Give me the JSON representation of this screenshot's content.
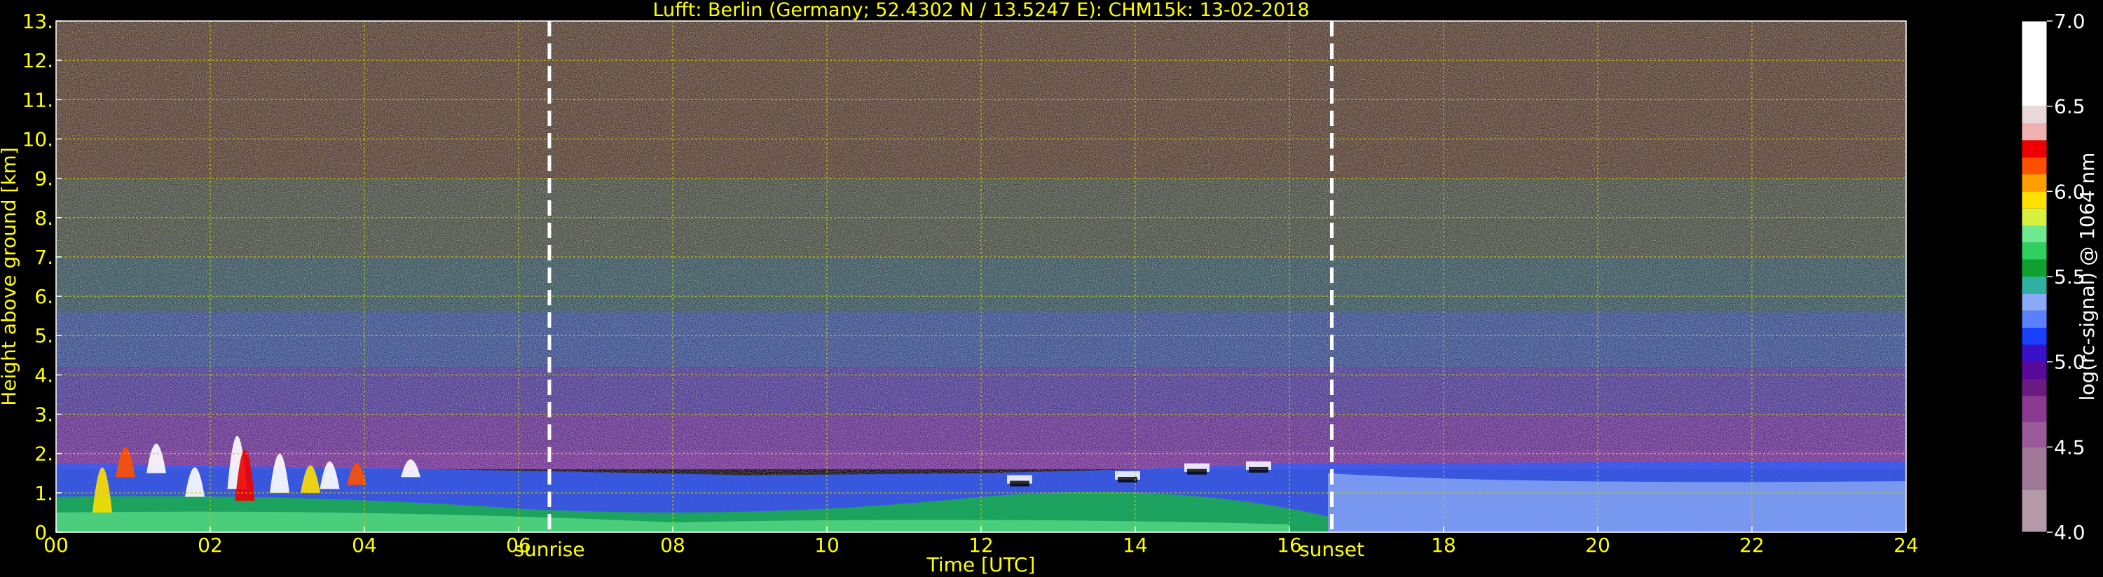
{
  "chart_data": {
    "type": "heatmap",
    "title": "Lufft: Berlin (Germany; 52.4302 N / 13.5247 E):    CHM15k: 13-02-2018",
    "xlabel": "Time [UTC]",
    "ylabel": "Height above ground [km]",
    "xlim": [
      0,
      24
    ],
    "ylim": [
      0,
      13
    ],
    "x_ticks": [
      {
        "value": 0,
        "label": "00"
      },
      {
        "value": 2,
        "label": "02"
      },
      {
        "value": 4,
        "label": "04"
      },
      {
        "value": 6,
        "label": "06"
      },
      {
        "value": 8,
        "label": "08"
      },
      {
        "value": 10,
        "label": "10"
      },
      {
        "value": 12,
        "label": "12"
      },
      {
        "value": 14,
        "label": "14"
      },
      {
        "value": 16,
        "label": "16"
      },
      {
        "value": 18,
        "label": "18"
      },
      {
        "value": 20,
        "label": "20"
      },
      {
        "value": 22,
        "label": "22"
      },
      {
        "value": 24,
        "label": "24"
      }
    ],
    "y_ticks": [
      {
        "value": 0,
        "label": "0."
      },
      {
        "value": 1,
        "label": "1."
      },
      {
        "value": 2,
        "label": "2."
      },
      {
        "value": 3,
        "label": "3."
      },
      {
        "value": 4,
        "label": "4."
      },
      {
        "value": 5,
        "label": "5."
      },
      {
        "value": 6,
        "label": "6."
      },
      {
        "value": 7,
        "label": "7."
      },
      {
        "value": 8,
        "label": "8."
      },
      {
        "value": 9,
        "label": "9."
      },
      {
        "value": 10,
        "label": "10."
      },
      {
        "value": 11,
        "label": "11."
      },
      {
        "value": 12,
        "label": "12."
      },
      {
        "value": 13,
        "label": "13."
      }
    ],
    "grid": true,
    "annotations": [
      {
        "text": "sunrise",
        "x": 6.4
      },
      {
        "text": "sunset",
        "x": 16.55
      }
    ],
    "colorbar": {
      "label": "log(rc-signal) @ 1064 nm",
      "range": [
        4.0,
        7.0
      ],
      "ticks": [
        {
          "value": 4.0,
          "label": "4.0"
        },
        {
          "value": 4.5,
          "label": "4.5"
        },
        {
          "value": 5.0,
          "label": "5.0"
        },
        {
          "value": 5.5,
          "label": "5.5"
        },
        {
          "value": 6.0,
          "label": "6.0"
        },
        {
          "value": 6.5,
          "label": "6.5"
        },
        {
          "value": 7.0,
          "label": "7.0"
        }
      ],
      "levels": [
        {
          "from": 4.0,
          "to": 4.25,
          "color": "#b49aa8"
        },
        {
          "from": 4.25,
          "to": 4.5,
          "color": "#a07898"
        },
        {
          "from": 4.5,
          "to": 4.65,
          "color": "#9a5a9a"
        },
        {
          "from": 4.65,
          "to": 4.8,
          "color": "#8a3a90"
        },
        {
          "from": 4.8,
          "to": 4.9,
          "color": "#6a1a80"
        },
        {
          "from": 4.9,
          "to": 5.0,
          "color": "#5a0a9a"
        },
        {
          "from": 5.0,
          "to": 5.1,
          "color": "#3a10c8"
        },
        {
          "from": 5.1,
          "to": 5.2,
          "color": "#1a40ff"
        },
        {
          "from": 5.2,
          "to": 5.3,
          "color": "#5a80ff"
        },
        {
          "from": 5.3,
          "to": 5.4,
          "color": "#8aaaf8"
        },
        {
          "from": 5.4,
          "to": 5.5,
          "color": "#30b0a0"
        },
        {
          "from": 5.5,
          "to": 5.6,
          "color": "#10a030"
        },
        {
          "from": 5.6,
          "to": 5.7,
          "color": "#30d060"
        },
        {
          "from": 5.7,
          "to": 5.8,
          "color": "#70e890"
        },
        {
          "from": 5.8,
          "to": 5.9,
          "color": "#d8f040"
        },
        {
          "from": 5.9,
          "to": 6.0,
          "color": "#ffe000"
        },
        {
          "from": 6.0,
          "to": 6.1,
          "color": "#ffa000"
        },
        {
          "from": 6.1,
          "to": 6.2,
          "color": "#ff5000"
        },
        {
          "from": 6.2,
          "to": 6.3,
          "color": "#ee0000"
        },
        {
          "from": 6.3,
          "to": 6.4,
          "color": "#f0b0b0"
        },
        {
          "from": 6.4,
          "to": 6.5,
          "color": "#e8d8d8"
        },
        {
          "from": 6.5,
          "to": 7.0,
          "color": "#ffffff"
        }
      ]
    },
    "colors": {
      "text": "#ffff00",
      "grid": "#c8c800",
      "marker": "#ffffff",
      "background": "#000000"
    }
  }
}
